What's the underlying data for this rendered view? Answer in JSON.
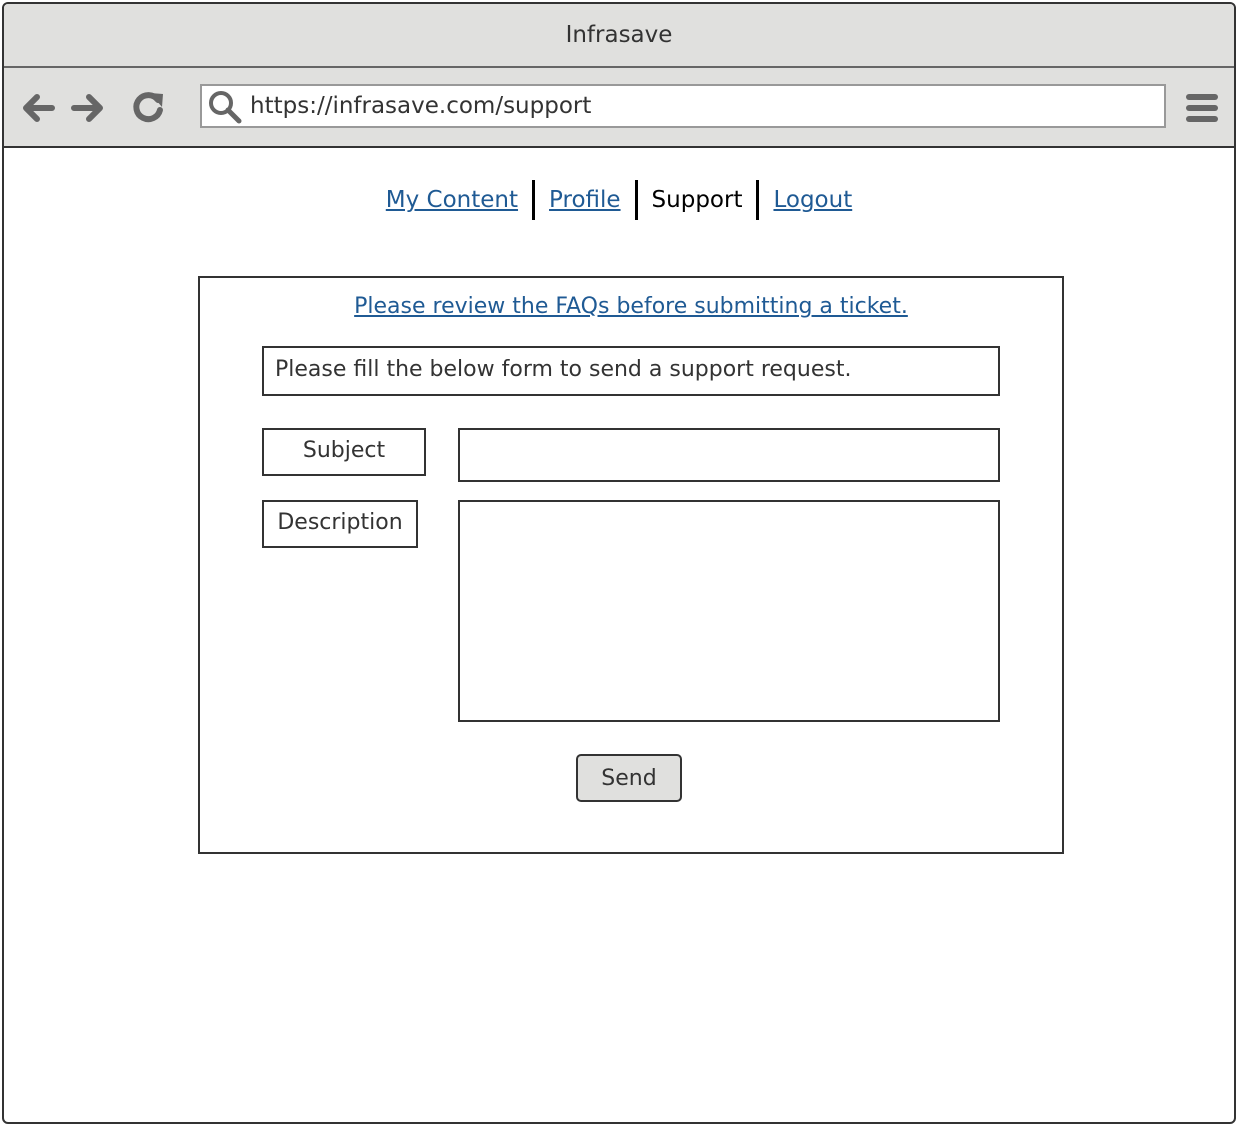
{
  "window": {
    "title": "Infrasave"
  },
  "browser": {
    "url": "https://infrasave.com/support",
    "icons": {
      "back": "arrow-left-icon",
      "forward": "arrow-right-icon",
      "reload": "reload-icon",
      "search": "search-icon",
      "menu": "hamburger-menu-icon"
    }
  },
  "nav": {
    "items": [
      {
        "label": "My Content",
        "current": false
      },
      {
        "label": "Profile",
        "current": false
      },
      {
        "label": "Support",
        "current": true
      },
      {
        "label": "Logout",
        "current": false
      }
    ]
  },
  "support": {
    "faq_link": "Please review the FAQs before submitting a ticket.",
    "instructions": "Please fill the below form to send a support request.",
    "subject_label": "Subject",
    "subject_value": "",
    "description_label": "Description",
    "description_value": "",
    "send_label": "Send"
  },
  "colors": {
    "chrome": "#e0e0de",
    "link": "#1f5a94",
    "border": "#333333",
    "icon": "#666666"
  }
}
